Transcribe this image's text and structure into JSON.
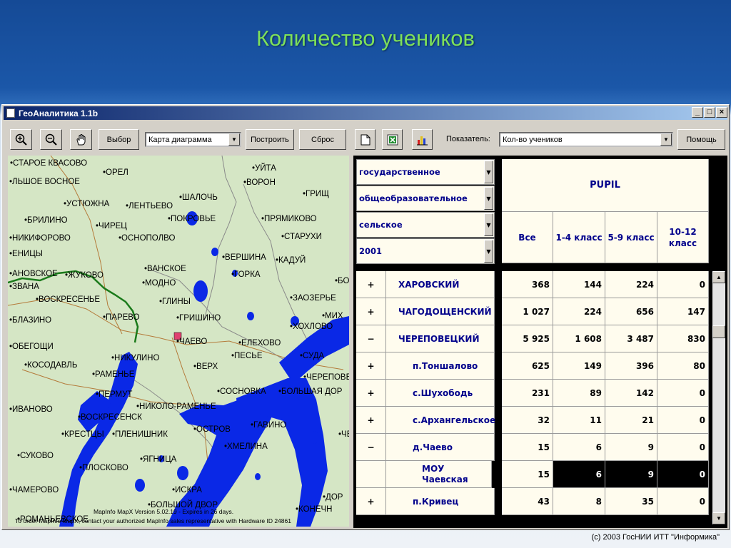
{
  "slide": {
    "title": "Количество учеников",
    "copyright": "(c) 2003 ГосНИИ ИТТ \"Информика\""
  },
  "window": {
    "title": "ГеоАналитика 1.1b",
    "controls": [
      "_",
      "□",
      "×"
    ]
  },
  "toolbar": {
    "zoom_in_icon": "zoom-in-icon",
    "zoom_out_icon": "zoom-out-icon",
    "pan_icon": "hand-icon",
    "select_label": "Выбор",
    "map_type_value": "Карта диаграмма",
    "build_label": "Построить",
    "reset_label": "Сброс",
    "indicator_label": "Показатель:",
    "indicator_value": "Кол-во учеников",
    "help_label": "Помощь"
  },
  "map": {
    "towns": [
      "СТАРОЕ КВАСОВО",
      "ОРЕЛ",
      "УЙТА",
      "ВОРОН",
      "ЛЬШОЕ ВОСНОЕ",
      "ШАЛОЧЬ",
      "ГРИЩ",
      "УСТЮЖНА",
      "ЛЕНТЬЕВО",
      "ПОКРОВЬЕ",
      "ПРЯМИКОВО",
      "БРИЛИНО",
      "ЧИРЕЦ",
      "СТАРУХИ",
      "НИКИФОРОВО",
      "ОСНОПОЛВО",
      "ВЕРШИНА",
      "ЕНИЦЫ",
      "ВАНСКОЕ",
      "КАДУЙ",
      "АНОВСКОЕ",
      "ЖУКОВО",
      "ГОРКА",
      "БО",
      "ЗВАНА",
      "МОДНО",
      "ВОСКРЕСЕНЬЕ",
      "ЗАОЗЕРЬЕ",
      "ГЛИНЫ",
      "БЛАЗИНО",
      "ПАРЕВО",
      "ГРИШИНО",
      "МИХ",
      "ХОХЛОВО",
      "ОБЕГОЩИ",
      "ЧАЕВО",
      "ЕЛЕХОВО",
      "КОСОДАВЛЬ",
      "НИКУЛИНО",
      "ПЕСЬЕ",
      "СУДА",
      "ВЕРХ",
      "ЧЕРЕПОВЕ",
      "РАМЕНЬЕ",
      "ПЕРМУТ",
      "СОСНОВКА",
      "БОЛЬШАЯ ДОР",
      "ИВАНОВО",
      "НИКОЛО-РАМЕНЬЕ",
      "ВОСКРЕСЕНСК",
      "ГАВИНО",
      "КРЕСТЦЫ",
      "ПЛЕНИШНИК",
      "ОСТРОВ",
      "ЧЕР",
      "СУКОВО",
      "ХМЕЛИНА",
      "ЯГНИЦА",
      "ПЛОСКОВО",
      "ЧАМЕРОВО",
      "ИСКРА",
      "ДОР",
      "БОЛЬШОЙ ДВОР",
      "РОМАНЬЕВСКОЕ",
      "КОНЕЧН"
    ],
    "mapinfo_line1": "MapInfo MapX Version 5.02.19 - Expires in 26 days.",
    "mapinfo_line2": "To order MapInfo MapX, contact your authorized MapInfo sales representative with Hardware ID 24861"
  },
  "filters": [
    "государственное",
    "общеобразовательное",
    "сельское",
    "2001"
  ],
  "table": {
    "group_header": "PUPIL",
    "columns": [
      "Все",
      "1-4 класс",
      "5-9 класс",
      "10-12 класс"
    ],
    "rows": [
      {
        "pm": "+",
        "name": "ХАРОВСКИЙ",
        "v": [
          "368",
          "144",
          "224",
          "0"
        ]
      },
      {
        "pm": "+",
        "name": "ЧАГОДОЩЕНСКИЙ",
        "v": [
          "1 027",
          "224",
          "656",
          "147"
        ]
      },
      {
        "pm": "−",
        "name": "ЧЕРЕПОВЕЦКИЙ",
        "v": [
          "5 925",
          "1 608",
          "3 487",
          "830"
        ]
      },
      {
        "pm": "+",
        "name": "п.Тоншалово",
        "v": [
          "625",
          "149",
          "396",
          "80"
        ]
      },
      {
        "pm": "+",
        "name": "с.Шухободь",
        "v": [
          "231",
          "89",
          "142",
          "0"
        ]
      },
      {
        "pm": "+",
        "name": "с.Архангельское",
        "v": [
          "32",
          "11",
          "21",
          "0"
        ]
      },
      {
        "pm": "−",
        "name": "д.Чаево",
        "v": [
          "15",
          "6",
          "9",
          "0"
        ]
      },
      {
        "pm": "",
        "name": "МОУ Чаевская",
        "v": [
          "15",
          "6",
          "9",
          "0"
        ]
      },
      {
        "pm": "+",
        "name": "п.Кривец",
        "v": [
          "43",
          "8",
          "35",
          "0"
        ]
      }
    ]
  },
  "colors": {
    "water": "#0a28e6",
    "land": "#d5e6c5",
    "border": "#1a7a1a",
    "roads": "#b47a3a",
    "title": "#7ee05a",
    "grid_cell": "#fffcee",
    "grid_text": "#00008b",
    "selected_row": "#000000"
  }
}
